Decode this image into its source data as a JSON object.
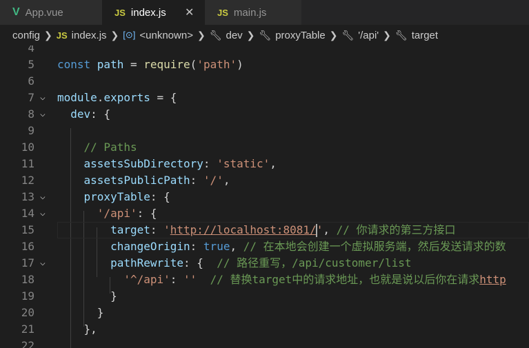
{
  "tabs": [
    {
      "label": "App.vue",
      "icon": "V"
    },
    {
      "label": "index.js",
      "icon": "JS",
      "close": "✕"
    },
    {
      "label": "main.js",
      "icon": "JS"
    }
  ],
  "breadcrumb": {
    "folder": "config",
    "file": "index.js",
    "items": [
      "<unknown>",
      "dev",
      "proxyTable",
      "'/api'",
      "target"
    ]
  },
  "lines": [
    {
      "n": "4"
    },
    {
      "n": "5",
      "tokens": [
        [
          "kw",
          "const "
        ],
        [
          "var",
          "path"
        ],
        [
          "pun",
          " = "
        ],
        [
          "fn",
          "require"
        ],
        [
          "pun",
          "("
        ],
        [
          "str",
          "'path'"
        ],
        [
          "pun",
          ")"
        ]
      ]
    },
    {
      "n": "6"
    },
    {
      "n": "7",
      "tokens": [
        [
          "var",
          "module"
        ],
        [
          "pun",
          "."
        ],
        [
          "var",
          "exports"
        ],
        [
          "pun",
          " = {"
        ]
      ]
    },
    {
      "n": "8",
      "tokens": [
        [
          "pun",
          "  "
        ],
        [
          "var",
          "dev"
        ],
        [
          "pun",
          ": {"
        ]
      ]
    },
    {
      "n": "9"
    },
    {
      "n": "10",
      "tokens": [
        [
          "pun",
          "    "
        ],
        [
          "cm",
          "// Paths"
        ]
      ]
    },
    {
      "n": "11",
      "tokens": [
        [
          "pun",
          "    "
        ],
        [
          "var",
          "assetsSubDirectory"
        ],
        [
          "pun",
          ": "
        ],
        [
          "str",
          "'static'"
        ],
        [
          "pun",
          ","
        ]
      ]
    },
    {
      "n": "12",
      "tokens": [
        [
          "pun",
          "    "
        ],
        [
          "var",
          "assetsPublicPath"
        ],
        [
          "pun",
          ": "
        ],
        [
          "str",
          "'/'"
        ],
        [
          "pun",
          ","
        ]
      ]
    },
    {
      "n": "13",
      "tokens": [
        [
          "pun",
          "    "
        ],
        [
          "var",
          "proxyTable"
        ],
        [
          "pun",
          ": {"
        ]
      ]
    },
    {
      "n": "14",
      "tokens": [
        [
          "pun",
          "      "
        ],
        [
          "str",
          "'/api'"
        ],
        [
          "pun",
          ": {"
        ]
      ]
    },
    {
      "n": "15",
      "tokens": [
        [
          "pun",
          "        "
        ],
        [
          "var",
          "target"
        ],
        [
          "pun",
          ": "
        ],
        [
          "str",
          "'"
        ],
        [
          "url",
          "http://localhost:8081/"
        ],
        [
          "str",
          "'"
        ],
        [
          "pun",
          ", "
        ],
        [
          "cm",
          "// 你请求的第三方接口"
        ]
      ]
    },
    {
      "n": "16",
      "tokens": [
        [
          "pun",
          "        "
        ],
        [
          "var",
          "changeOrigin"
        ],
        [
          "pun",
          ": "
        ],
        [
          "num",
          "true"
        ],
        [
          "pun",
          ", "
        ],
        [
          "cm",
          "// 在本地会创建一个虚拟服务端，然后发送请求的数"
        ]
      ]
    },
    {
      "n": "17",
      "tokens": [
        [
          "pun",
          "        "
        ],
        [
          "var",
          "pathRewrite"
        ],
        [
          "pun",
          ": {  "
        ],
        [
          "cm",
          "// 路径重写，/api/customer/list"
        ]
      ]
    },
    {
      "n": "18",
      "tokens": [
        [
          "pun",
          "          "
        ],
        [
          "str",
          "'^/api'"
        ],
        [
          "pun",
          ": "
        ],
        [
          "str",
          "''"
        ],
        [
          "pun",
          "  "
        ],
        [
          "cm",
          "// 替换target中的请求地址，也就是说以后你在请求"
        ],
        [
          "url",
          "http"
        ]
      ]
    },
    {
      "n": "19",
      "tokens": [
        [
          "pun",
          "        }"
        ]
      ]
    },
    {
      "n": "20",
      "tokens": [
        [
          "pun",
          "      }"
        ]
      ]
    },
    {
      "n": "21",
      "tokens": [
        [
          "pun",
          "    },"
        ]
      ]
    },
    {
      "n": "22"
    }
  ],
  "folds": [
    "7",
    "8",
    "13",
    "14",
    "17"
  ]
}
